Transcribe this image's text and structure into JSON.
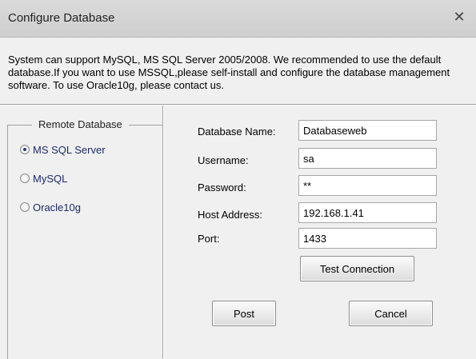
{
  "window": {
    "title": "Configure Database",
    "close_glyph": "✕"
  },
  "description": "System can support MySQL, MS SQL Server 2005/2008. We recommended to use the default database.If you want to use MSSQL,please self-install and configure the database management software. To use Oracle10g, please contact us.",
  "remote_database": {
    "legend": "Remote Database",
    "options": [
      {
        "label": "MS SQL Server",
        "selected": true
      },
      {
        "label": "MySQL",
        "selected": false
      },
      {
        "label": "Oracle10g",
        "selected": false
      }
    ]
  },
  "form": {
    "database_name": {
      "label": "Database Name:",
      "value": "Databaseweb"
    },
    "username": {
      "label": "Username:",
      "value": "sa"
    },
    "password": {
      "label": "Password:",
      "value": "**"
    },
    "host_address": {
      "label": "Host Address:",
      "value": "192.168.1.41"
    },
    "port": {
      "label": "Port:",
      "value": "1433"
    }
  },
  "buttons": {
    "test_connection": "Test Connection",
    "post": "Post",
    "cancel": "Cancel"
  }
}
